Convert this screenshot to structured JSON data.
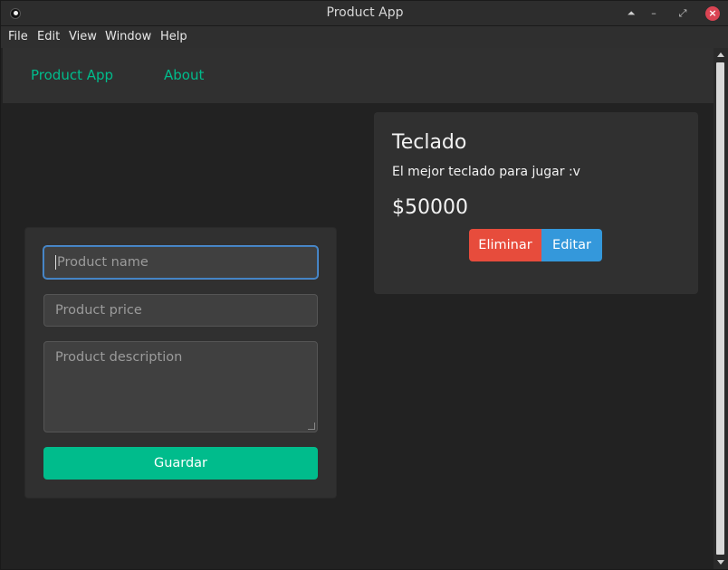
{
  "window": {
    "title": "Product App"
  },
  "menu": [
    "File",
    "Edit",
    "View",
    "Window",
    "Help"
  ],
  "navbar": {
    "brand": "Product App",
    "about": "About"
  },
  "form": {
    "name_placeholder": "Product name",
    "price_placeholder": "Product price",
    "description_placeholder": "Product description",
    "save_label": "Guardar"
  },
  "product": {
    "name": "Teclado",
    "description": "El mejor teclado para jugar :v",
    "price": "$50000",
    "delete_label": "Eliminar",
    "edit_label": "Editar"
  },
  "colors": {
    "accent": "#00bc8c",
    "danger": "#e74c3c",
    "info": "#3498db",
    "background": "#222222",
    "card": "#303030"
  },
  "icons": {
    "app": "app-logo-icon",
    "keep_above": "keep-above-icon",
    "minimize": "minimize-icon",
    "maximize": "maximize-icon",
    "close": "close-icon"
  }
}
